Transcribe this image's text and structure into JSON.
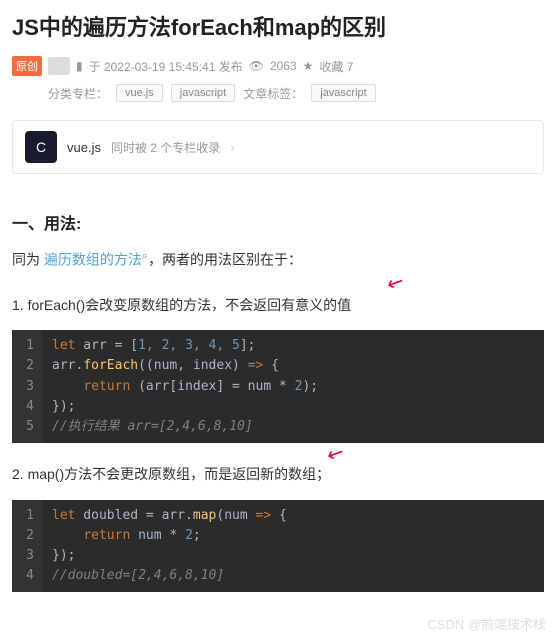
{
  "title": "JS中的遍历方法forEach和map的区别",
  "meta": {
    "badge": "原创",
    "pub_prefix": "于 ",
    "pub_time": "2022-03-19 15:45:41 发布",
    "views_icon": "👁",
    "views": "2063",
    "fav_icon": "★",
    "fav_label": "收藏 7"
  },
  "tags": {
    "cat_label": "分类专栏：",
    "cat_items": [
      "vue.js",
      "javascript"
    ],
    "art_label": "文章标签：",
    "art_items": [
      "javascript"
    ]
  },
  "collection": {
    "logo": "C",
    "name": "vue.js",
    "sub": "同时被 2 个专栏收录",
    "arrow": "›"
  },
  "section": {
    "h2": "一、用法:",
    "intro_pre": "同为 ",
    "intro_link": "遍历数组的方法",
    "intro_post": "，两者的用法区别在于：",
    "item1": "1. forEach()会改变原数组的方法，不会返回有意义的值",
    "item2": "2. map()方法不会更改原数组，而是返回新的数组；"
  },
  "code1": {
    "lines": [
      1,
      2,
      3,
      4,
      5
    ],
    "l1_kw": "let",
    "l1_rest": " arr = [",
    "l1_nums": "1, 2, 3, 4, 5",
    "l1_end": "];",
    "l2_pre": "arr.",
    "l2_fn": "forEach",
    "l2_par": "((num, index) ",
    "l2_arrow": "=>",
    "l2_brace": " {",
    "l3_indent": "    ",
    "l3_kw": "return",
    "l3_rest": " (arr[index] = num * ",
    "l3_num": "2",
    "l3_end": ");",
    "l4": "});",
    "l5_cm": "//执行结果 arr=[2,4,6,8,10]"
  },
  "code2": {
    "lines": [
      1,
      2,
      3,
      4
    ],
    "l1_kw": "let",
    "l1_rest": " doubled = arr.",
    "l1_fn": "map",
    "l1_par": "(num ",
    "l1_arrow": "=>",
    "l1_brace": " {",
    "l2_indent": "    ",
    "l2_kw": "return",
    "l2_rest": " num * ",
    "l2_num": "2",
    "l2_end": ";",
    "l3": "});",
    "l4_cm": "//doubled=[2,4,6,8,10]"
  },
  "watermark": "CSDN @前端技术栈",
  "chart_data": {
    "type": "table",
    "title": "Code snippets comparing forEach vs map",
    "snippets": [
      {
        "label": "forEach",
        "code": "let arr = [1, 2, 3, 4, 5];\narr.forEach((num, index) => {\n    return (arr[index] = num * 2);\n});\n//执行结果 arr=[2,4,6,8,10]"
      },
      {
        "label": "map",
        "code": "let doubled = arr.map(num => {\n    return num * 2;\n});\n//doubled=[2,4,6,8,10]"
      }
    ]
  }
}
